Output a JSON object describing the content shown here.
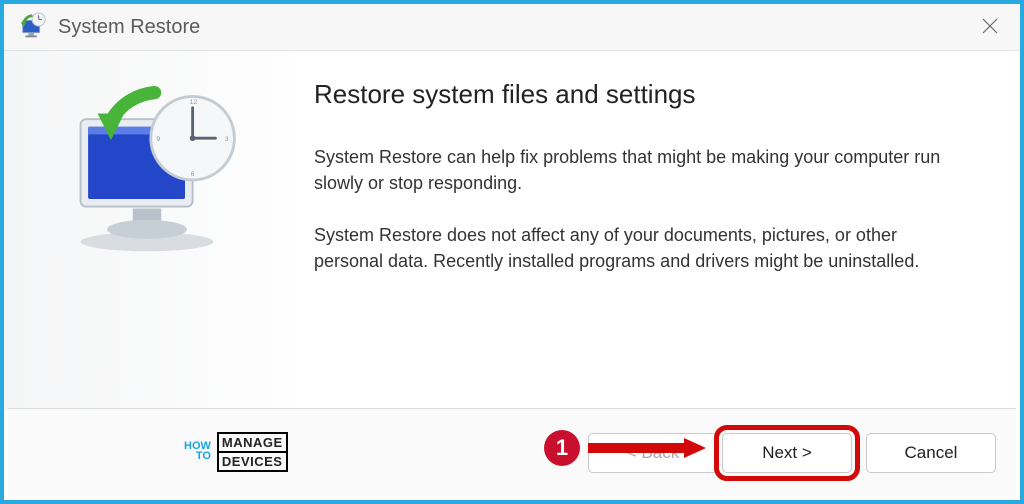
{
  "window": {
    "title": "System Restore"
  },
  "content": {
    "heading": "Restore system files and settings",
    "para1": "System Restore can help fix problems that might be making your computer run slowly or stop responding.",
    "para2": "System Restore does not affect any of your documents, pictures, or other personal data. Recently installed programs and drivers might be uninstalled."
  },
  "buttons": {
    "back": "< Back",
    "next": "Next >",
    "cancel": "Cancel"
  },
  "annotation": {
    "step": "1"
  },
  "watermark": {
    "how": "HOW",
    "to": "TO",
    "manage": "MANAGE",
    "devices": "DEVICES"
  }
}
